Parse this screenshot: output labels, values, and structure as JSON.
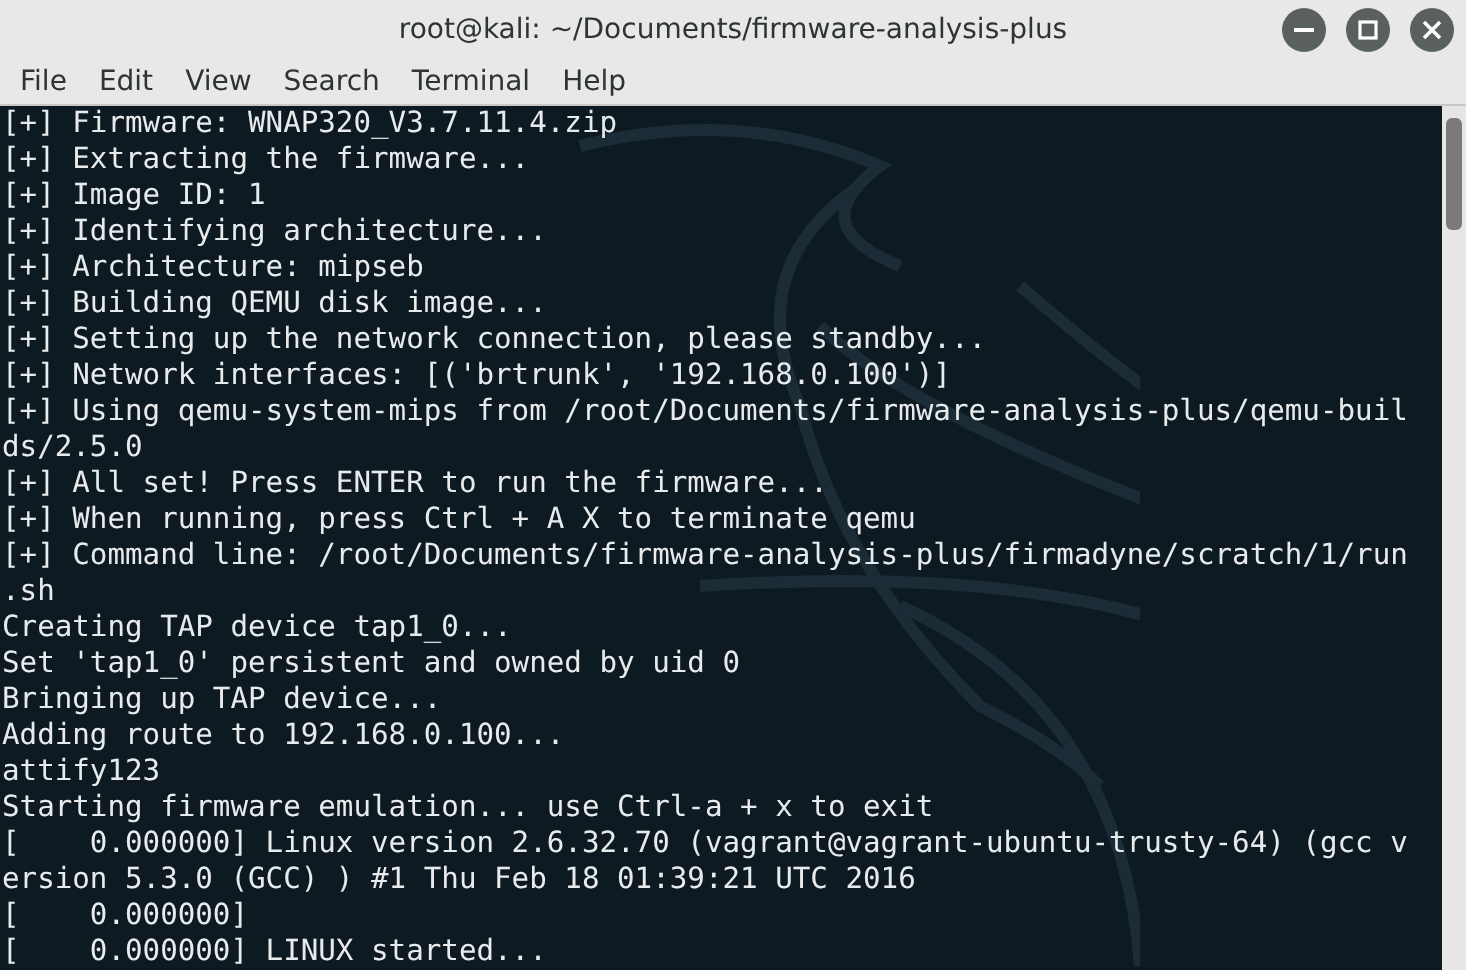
{
  "window": {
    "title": "root@kali: ~/Documents/firmware-analysis-plus"
  },
  "menu": [
    "File",
    "Edit",
    "View",
    "Search",
    "Terminal",
    "Help"
  ],
  "terminal": {
    "lines": [
      "[+] Firmware: WNAP320_V3.7.11.4.zip",
      "[+] Extracting the firmware...",
      "[+] Image ID: 1",
      "[+] Identifying architecture...",
      "[+] Architecture: mipseb",
      "[+] Building QEMU disk image...",
      "[+] Setting up the network connection, please standby...",
      "[+] Network interfaces: [('brtrunk', '192.168.0.100')]",
      "[+] Using qemu-system-mips from /root/Documents/firmware-analysis-plus/qemu-buil",
      "ds/2.5.0",
      "[+] All set! Press ENTER to run the firmware...",
      "[+] When running, press Ctrl + A X to terminate qemu",
      "[+] Command line: /root/Documents/firmware-analysis-plus/firmadyne/scratch/1/run",
      ".sh",
      "Creating TAP device tap1_0...",
      "Set 'tap1_0' persistent and owned by uid 0",
      "Bringing up TAP device...",
      "Adding route to 192.168.0.100...",
      "attify123",
      "Starting firmware emulation... use Ctrl-a + x to exit",
      "[    0.000000] Linux version 2.6.32.70 (vagrant@vagrant-ubuntu-trusty-64) (gcc v",
      "ersion 5.3.0 (GCC) ) #1 Thu Feb 18 01:39:21 UTC 2016",
      "[    0.000000]",
      "[    0.000000] LINUX started..."
    ]
  }
}
